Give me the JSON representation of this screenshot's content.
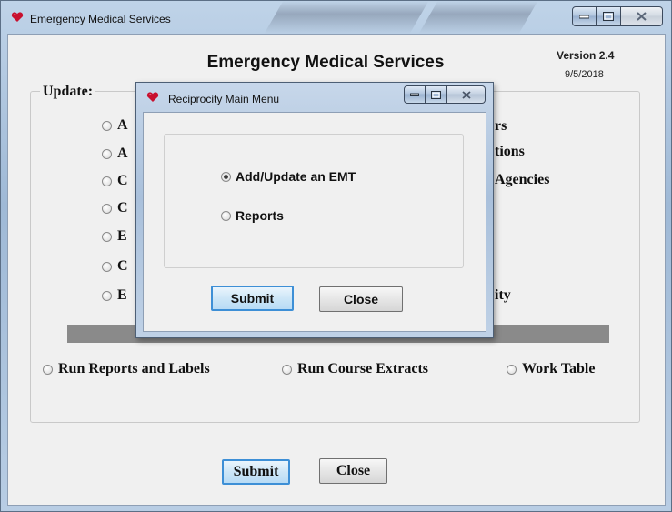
{
  "window": {
    "title": "Emergency Medical Services",
    "app_title": "Emergency Medical Services",
    "version": "Version 2.4",
    "date": "9/5/2018",
    "update_label": "Update:",
    "update_options": [
      "A",
      "A",
      "C",
      "C",
      "E",
      "C",
      "E"
    ],
    "right_fragments": [
      "rs",
      "tions",
      "Agencies",
      "ity"
    ],
    "bottom_options": [
      {
        "label": "Run Reports and Labels",
        "checked": false
      },
      {
        "label": "Run Course Extracts",
        "checked": false
      },
      {
        "label": "Work Table",
        "checked": false
      }
    ],
    "submit_label": "Submit",
    "close_label": "Close"
  },
  "dialog": {
    "title": "Reciprocity Main Menu",
    "options": [
      {
        "label": "Add/Update an EMT",
        "checked": true
      },
      {
        "label": "Reports",
        "checked": false
      }
    ],
    "submit_label": "Submit",
    "close_label": "Close"
  },
  "icons": {
    "app": "heart-icon",
    "minimize": "minimize-icon",
    "maximize": "maximize-icon",
    "close": "close-icon"
  },
  "colors": {
    "heart": "#c8102e",
    "default_button_border": "#3d8fd6"
  }
}
